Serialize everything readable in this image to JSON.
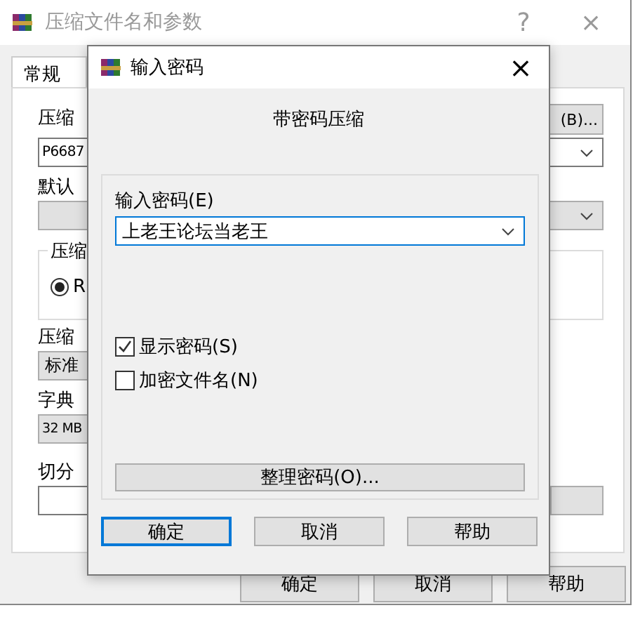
{
  "window": {
    "title": "压缩文件名和参数",
    "help": "?",
    "close": "×"
  },
  "tabs": [
    {
      "label": "常规",
      "selected": true
    }
  ],
  "general": {
    "archive_name_label": "压缩",
    "browse_button": "(B)...",
    "archive_name": "P6687",
    "profile_label": "默认",
    "format_group_label": "压缩",
    "format_options": [
      {
        "label": "R",
        "selected": true
      }
    ],
    "method_label": "压缩",
    "method": "标准",
    "dictionary_label": "字典",
    "dictionary": "32 MB",
    "split_label": "切分"
  },
  "buttons": [
    {
      "label": "确定"
    },
    {
      "label": "取消"
    },
    {
      "label": "帮助"
    }
  ],
  "password_dialog": {
    "title": "输入密码",
    "close": "×",
    "heading": "带密码压缩",
    "password_label": "输入密码(E)",
    "password": "上老王论坛当老王",
    "options": [
      {
        "label": "显示密码(S)",
        "checked": true
      },
      {
        "label": "加密文件名(N)",
        "checked": false
      }
    ],
    "organize_button": "整理密码(O)...",
    "buttons": [
      {
        "label": "确定",
        "default": true
      },
      {
        "label": "取消",
        "default": false
      },
      {
        "label": "帮助",
        "default": false
      }
    ]
  }
}
